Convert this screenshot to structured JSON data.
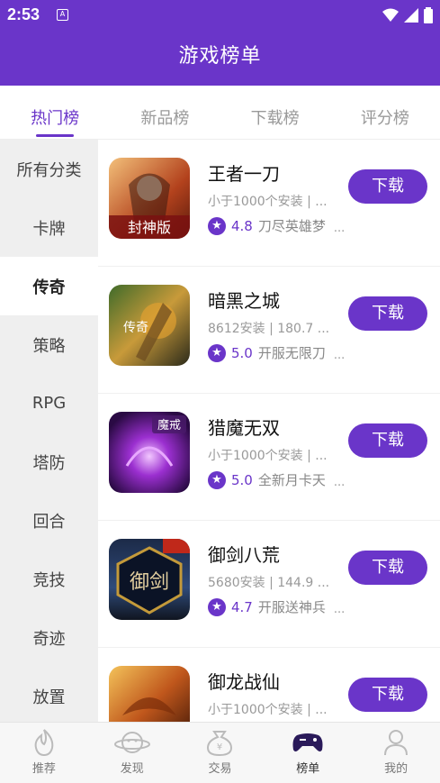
{
  "status_bar": {
    "time": "2:53",
    "notif_glyph": "A"
  },
  "header": {
    "title": "游戏榜单"
  },
  "tabs": [
    {
      "label": "热门榜",
      "active": true
    },
    {
      "label": "新品榜",
      "active": false
    },
    {
      "label": "下载榜",
      "active": false
    },
    {
      "label": "评分榜",
      "active": false
    }
  ],
  "categories": [
    {
      "label": "所有分类"
    },
    {
      "label": "卡牌"
    },
    {
      "label": "传奇",
      "active": true
    },
    {
      "label": "策略"
    },
    {
      "label": "RPG"
    },
    {
      "label": "塔防"
    },
    {
      "label": "回合"
    },
    {
      "label": "竞技"
    },
    {
      "label": "奇迹"
    },
    {
      "label": "放置"
    }
  ],
  "games": [
    {
      "name": "王者一刀",
      "meta": "小于1000个安装 | ...",
      "score": "4.8",
      "desc": "刀尽英雄梦",
      "more": "...",
      "download": "下载",
      "icon_text": "封神版"
    },
    {
      "name": "暗黑之城",
      "meta": "8612安装 | 180.7 ...",
      "score": "5.0",
      "desc": "开服无限刀",
      "more": "...",
      "download": "下载",
      "icon_text": "传奇"
    },
    {
      "name": "猎魔无双",
      "meta": "小于1000个安装 | ...",
      "score": "5.0",
      "desc": "全新月卡天",
      "more": "...",
      "download": "下载",
      "icon_text": "魔戒"
    },
    {
      "name": "御剑八荒",
      "meta": "5680安装 | 144.9 ...",
      "score": "4.7",
      "desc": "开服送神兵",
      "more": "...",
      "download": "下载",
      "icon_text": "御剑"
    },
    {
      "name": "御龙战仙",
      "meta": "小于1000个安装 | ...",
      "score": "",
      "desc": "",
      "more": "",
      "download": "下载",
      "icon_text": ""
    }
  ],
  "bottom_nav": [
    {
      "label": "推荐",
      "icon": "flame-icon"
    },
    {
      "label": "发现",
      "icon": "planet-icon"
    },
    {
      "label": "交易",
      "icon": "money-bag-icon"
    },
    {
      "label": "榜单",
      "icon": "gamepad-icon",
      "active": true
    },
    {
      "label": "我的",
      "icon": "person-icon"
    }
  ],
  "colors": {
    "accent": "#6a35c9",
    "sidebar_bg": "#efefef"
  }
}
